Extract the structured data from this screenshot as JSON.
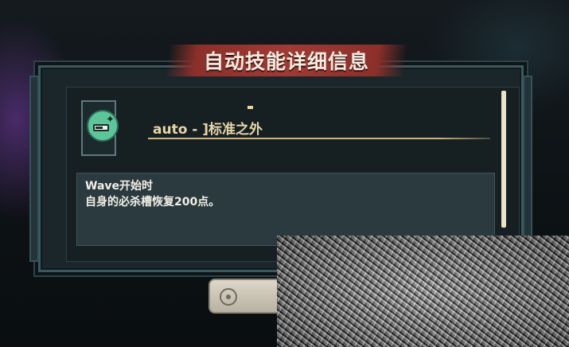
{
  "dialog": {
    "title": "自动技能详细信息",
    "skill": {
      "icon": "skill-gauge-icon",
      "name": "auto - ]标准之外"
    },
    "description": {
      "line1": "Wave开始时",
      "line2": "自身的必杀槽恢复200点。"
    },
    "close_button_icon": "close-icon"
  },
  "colors": {
    "title_banner": "#a03a33",
    "title_text": "#f4ece0",
    "skill_name": "#e8d6a6",
    "skill_icon_bg": "#5cc59a",
    "panel_bg": "#161f22",
    "description_bg": "#2a3a3f"
  }
}
